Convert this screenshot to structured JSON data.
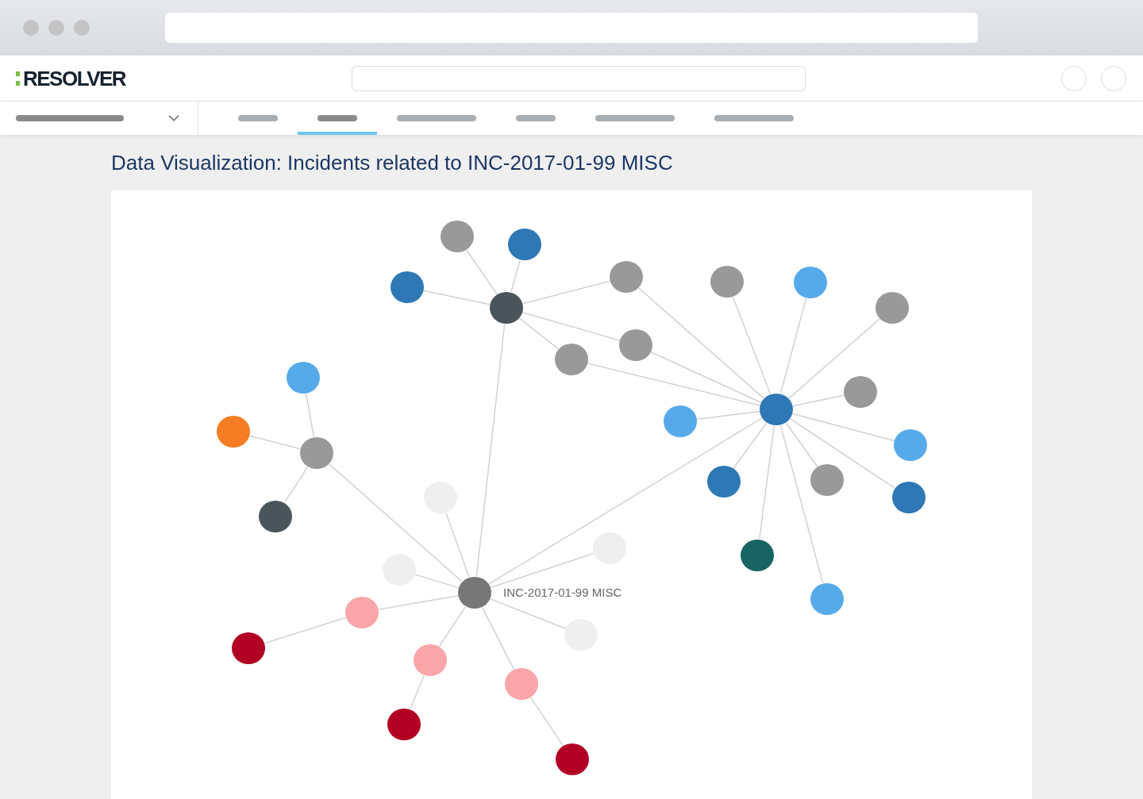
{
  "header": {
    "logo": "RESOLVER"
  },
  "nav": {
    "tabs": [
      {
        "selected": false
      },
      {
        "selected": true
      },
      {
        "selected": false
      },
      {
        "selected": false
      },
      {
        "selected": false
      },
      {
        "selected": false
      }
    ]
  },
  "title": "Data Visualization: Incidents related to INC-2017-01-99 MISC",
  "graph": {
    "root": {
      "color": "#777777",
      "label": "INC-2017-01-99 MISC",
      "children": [
        {
          "color": "#efefef"
        },
        {
          "color": "#efefef"
        },
        {
          "color": "#efefef"
        },
        {
          "color": "#efefef"
        },
        {
          "color": "#f9a5a9",
          "children": [
            {
              "color": "#b10023"
            }
          ]
        },
        {
          "color": "#f9a5a9",
          "children": [
            {
              "color": "#b10023"
            }
          ]
        },
        {
          "color": "#f9a5a9",
          "children": [
            {
              "color": "#b10023"
            }
          ]
        },
        {
          "color": "#4a555b",
          "children": [
            {
              "color": "#999999"
            },
            {
              "color": "#2e78b5"
            },
            {
              "color": "#2e78b5"
            },
            {
              "color": "#999999"
            },
            {
              "color": "#999999"
            },
            {
              "color": "#999999"
            }
          ]
        },
        {
          "color": "#2e78b5",
          "children": [
            {
              "color": "#999999"
            },
            {
              "color": "#56aaea"
            },
            {
              "color": "#999999"
            },
            {
              "color": "#999999"
            },
            {
              "color": "#56aaea"
            },
            {
              "color": "#2e78b5"
            },
            {
              "color": "#999999"
            },
            {
              "color": "#56aaea"
            },
            {
              "color": "#176462"
            },
            {
              "color": "#2e78b5"
            },
            {
              "color": "#56aaea"
            }
          ]
        },
        {
          "color": "#999999",
          "children": [
            {
              "color": "#56aaea"
            },
            {
              "color": "#f57c22"
            },
            {
              "color": "#4a555b"
            }
          ]
        }
      ]
    }
  }
}
